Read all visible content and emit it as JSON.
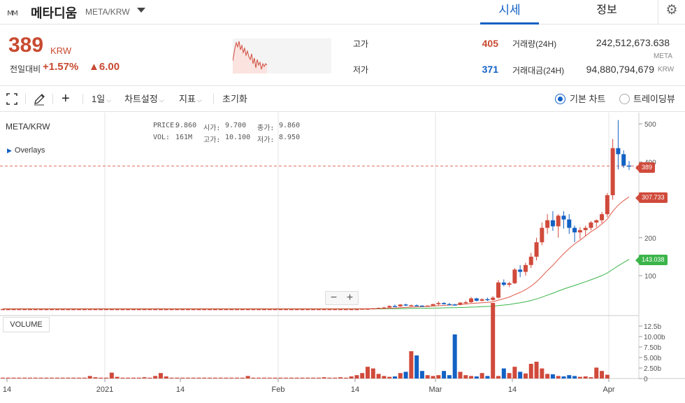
{
  "header": {
    "coin_name": "메타디움",
    "coin_pair": "META/KRW",
    "tabs": [
      "시세",
      "정보"
    ]
  },
  "summary": {
    "price": "389",
    "price_unit": "KRW",
    "prev_label": "전일대비",
    "change_pct": "+1.57%",
    "change_abs": "▲6.00",
    "high_label": "고가",
    "high_value": "405",
    "low_label": "저가",
    "low_value": "371",
    "volume_label": "거래량(24H)",
    "volume_value": "242,512,673.638",
    "volume_unit": "META",
    "amount_label": "거래대금(24H)",
    "amount_value": "94,880,794,679",
    "amount_unit": "KRW"
  },
  "toolbar": {
    "interval": "1일",
    "chart_settings": "차트설정",
    "indicators": "지표",
    "reset": "초기화",
    "basic_chart": "기본 차트",
    "tradingview": "트레이딩뷰",
    "basic_selected": true
  },
  "chart": {
    "symbol": "META/KRW",
    "overlays": "Overlays",
    "ohlc": {
      "price_label": "PRICE:",
      "price": "9.860",
      "open_label": "시가:",
      "open": "9.700",
      "close_label": "종가:",
      "close": "9.860",
      "vol_label": "VOL:",
      "vol": "161M",
      "high_label": "고가:",
      "high": "10.100",
      "low_label": "저가:",
      "low": "8.950"
    },
    "zoom_minus": "−",
    "zoom_plus": "+",
    "volume_label": "VOLUME",
    "current_badge": "389",
    "ma1_badge": "307.733",
    "ma2_badge": "143.038",
    "colors": {
      "up": "#d04a3b",
      "down": "#1261c4",
      "ma_short": "#e05a4a",
      "ma_long": "#3bb54a"
    }
  },
  "chart_data": {
    "type": "candlestick",
    "y_ticks": [
      "500",
      "400",
      "300",
      "200",
      "100"
    ],
    "vol_ticks": [
      "12.5b",
      "10.00b",
      "7.50b",
      "5.00b",
      "2.50b",
      "0"
    ],
    "x_ticks": [
      "14",
      "2021",
      "14",
      "Feb",
      "14",
      "Mar",
      "14",
      "Apr"
    ],
    "ylim": [
      0,
      530
    ],
    "current_price": 389,
    "ma_short_last": 307.733,
    "ma_long_last": 143.038,
    "candles": [
      [
        12,
        12,
        12,
        12
      ],
      [
        12,
        12,
        12,
        12
      ],
      [
        12,
        12,
        12,
        12
      ],
      [
        12,
        12,
        12,
        12
      ],
      [
        12,
        12,
        12,
        12
      ],
      [
        12,
        12,
        12,
        12
      ],
      [
        12,
        12,
        12,
        12
      ],
      [
        12,
        12,
        12,
        12
      ],
      [
        12,
        12,
        12,
        12
      ],
      [
        12,
        12,
        12,
        12
      ],
      [
        12,
        12,
        12,
        12
      ],
      [
        12,
        12,
        12,
        12
      ],
      [
        12,
        12,
        12,
        12
      ],
      [
        12,
        12,
        12,
        12
      ],
      [
        12,
        12,
        12,
        12
      ],
      [
        12,
        12,
        12,
        12
      ],
      [
        12,
        12,
        12,
        12
      ],
      [
        12,
        12,
        12,
        12
      ],
      [
        12,
        12,
        12,
        12
      ],
      [
        12,
        12,
        12,
        12
      ],
      [
        12,
        12,
        12,
        12
      ],
      [
        12,
        12,
        12,
        12
      ],
      [
        12,
        12,
        12,
        12
      ],
      [
        12,
        12,
        12,
        12
      ],
      [
        12,
        12,
        12,
        12
      ],
      [
        12,
        12,
        12,
        12
      ],
      [
        12,
        12,
        12,
        12
      ],
      [
        12,
        12,
        12,
        12
      ],
      [
        12,
        12,
        12,
        12
      ],
      [
        12,
        12,
        12,
        12
      ],
      [
        12,
        12,
        12,
        12
      ],
      [
        12,
        12,
        12,
        12
      ],
      [
        12,
        12,
        12,
        12
      ],
      [
        12,
        12,
        12,
        12
      ],
      [
        12,
        12,
        12,
        12
      ],
      [
        12,
        12,
        12,
        12
      ],
      [
        12,
        12,
        12,
        12
      ],
      [
        12,
        12,
        12,
        12
      ],
      [
        12,
        12,
        12,
        12
      ],
      [
        12,
        12,
        12,
        12
      ],
      [
        12,
        12,
        12,
        12
      ],
      [
        12,
        12,
        12,
        12
      ],
      [
        12,
        12,
        12,
        12
      ],
      [
        12,
        12,
        12,
        12
      ],
      [
        12,
        12,
        12,
        12
      ],
      [
        12,
        12,
        12,
        12
      ],
      [
        12,
        12,
        12,
        12
      ],
      [
        12,
        12,
        12,
        12
      ],
      [
        12,
        12,
        12,
        12
      ],
      [
        12,
        12,
        12,
        12
      ],
      [
        12,
        12,
        12,
        12
      ],
      [
        12,
        12,
        12,
        12
      ],
      [
        12,
        12,
        12,
        12
      ],
      [
        12,
        12,
        12,
        12
      ],
      [
        12,
        12,
        12,
        12
      ],
      [
        12,
        12,
        12,
        12
      ],
      [
        12,
        12,
        12,
        12
      ],
      [
        12,
        12,
        12,
        12
      ],
      [
        12,
        12,
        12,
        12
      ],
      [
        12,
        12,
        12,
        12
      ],
      [
        12,
        12,
        12,
        12
      ],
      [
        12,
        12,
        12,
        12
      ],
      [
        12,
        12,
        12,
        12
      ],
      [
        12,
        12,
        12,
        12
      ],
      [
        12,
        12,
        12,
        12
      ],
      [
        12,
        12,
        12,
        12
      ],
      [
        12,
        13,
        12,
        13
      ],
      [
        13,
        14,
        12,
        13
      ],
      [
        12,
        14,
        12,
        14
      ],
      [
        14,
        16,
        13,
        15
      ],
      [
        15,
        18,
        14,
        16
      ],
      [
        16,
        22,
        15,
        20
      ],
      [
        20,
        24,
        18,
        19
      ],
      [
        19,
        25,
        18,
        24
      ],
      [
        24,
        26,
        20,
        22
      ],
      [
        22,
        24,
        20,
        22
      ],
      [
        22,
        24,
        20,
        21
      ],
      [
        21,
        22,
        19,
        20
      ],
      [
        20,
        22,
        18,
        21
      ],
      [
        21,
        26,
        20,
        25
      ],
      [
        25,
        32,
        22,
        28
      ],
      [
        28,
        30,
        24,
        25
      ],
      [
        25,
        28,
        22,
        24
      ],
      [
        24,
        26,
        22,
        23
      ],
      [
        23,
        30,
        22,
        29
      ],
      [
        29,
        34,
        26,
        30
      ],
      [
        30,
        44,
        28,
        40
      ],
      [
        40,
        42,
        32,
        34
      ],
      [
        34,
        40,
        32,
        38
      ],
      [
        38,
        42,
        33,
        36
      ],
      [
        36,
        46,
        34,
        42
      ],
      [
        42,
        88,
        40,
        82
      ],
      [
        82,
        90,
        72,
        76
      ],
      [
        76,
        84,
        70,
        80
      ],
      [
        80,
        120,
        78,
        116
      ],
      [
        116,
        128,
        96,
        110
      ],
      [
        110,
        134,
        100,
        128
      ],
      [
        128,
        160,
        120,
        150
      ],
      [
        150,
        200,
        140,
        188
      ],
      [
        188,
        240,
        180,
        226
      ],
      [
        226,
        262,
        210,
        246
      ],
      [
        246,
        270,
        218,
        230
      ],
      [
        230,
        262,
        200,
        258
      ],
      [
        258,
        270,
        224,
        248
      ],
      [
        248,
        262,
        210,
        226
      ],
      [
        226,
        232,
        188,
        214
      ],
      [
        214,
        228,
        196,
        220
      ],
      [
        220,
        232,
        204,
        226
      ],
      [
        226,
        244,
        220,
        240
      ],
      [
        240,
        248,
        228,
        246
      ],
      [
        246,
        268,
        238,
        262
      ],
      [
        262,
        318,
        254,
        312
      ],
      [
        312,
        460,
        300,
        436
      ],
      [
        436,
        510,
        380,
        420
      ],
      [
        420,
        430,
        384,
        390
      ],
      [
        390,
        402,
        378,
        389
      ]
    ],
    "volumes": [
      0.2,
      0.2,
      0.2,
      0.2,
      0.2,
      0.2,
      0.2,
      0.2,
      0.2,
      0.2,
      0.2,
      0.2,
      0.2,
      0.2,
      0.2,
      0.2,
      0.6,
      0.3,
      0.2,
      0.2,
      1.4,
      0.4,
      0.2,
      0.2,
      0.2,
      0.2,
      0.3,
      0.2,
      0.6,
      1.3,
      0.5,
      0.2,
      0.2,
      0.2,
      0.2,
      0.2,
      0.2,
      0.2,
      0.2,
      0.2,
      0.2,
      0.2,
      0.2,
      0.2,
      0.2,
      0.6,
      0.2,
      0.2,
      0.2,
      0.2,
      0.2,
      0.2,
      0.2,
      0.2,
      0.2,
      0.2,
      0.2,
      0.2,
      0.2,
      0.3,
      0.2,
      0.2,
      0.3,
      0.2,
      0.5,
      0.8,
      1.3,
      2.8,
      2.4,
      1.1,
      0.6,
      0.4,
      0.5,
      1.3,
      1.6,
      6.5,
      5.5,
      1.8,
      0.8,
      0.6,
      0.8,
      1.8,
      0.8,
      10.5,
      1.6,
      0.8,
      0.6,
      0.5,
      1.3,
      0.6,
      18.0,
      0.6,
      2.4,
      1.3,
      2.8,
      1.6,
      1.2,
      3.5,
      4.0,
      2.4,
      1.1,
      1.0,
      0.6,
      0.5,
      0.8,
      0.6,
      0.4,
      0.5,
      0.3,
      2.6,
      1.8,
      0.9
    ]
  }
}
